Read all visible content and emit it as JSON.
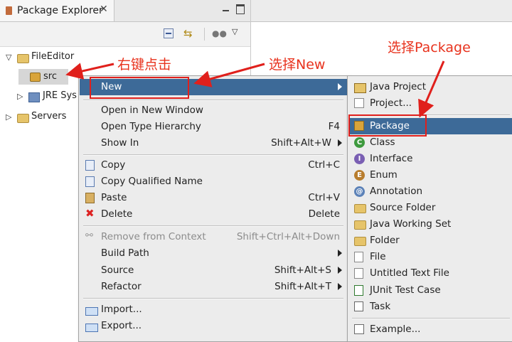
{
  "view": {
    "tab_title": "Package Explorer",
    "tab_close": "✕",
    "tree": {
      "fileeditor": "FileEditor",
      "src": "src",
      "jre": "JRE Sys",
      "servers": "Servers"
    }
  },
  "context_menu": {
    "items": [
      {
        "label": "New",
        "shortcut": "",
        "submenu": true,
        "selected": true,
        "icon": ""
      },
      {
        "label": "Open in New Window",
        "shortcut": "",
        "submenu": false,
        "icon": ""
      },
      {
        "label": "Open Type Hierarchy",
        "shortcut": "F4",
        "submenu": false,
        "icon": ""
      },
      {
        "label": "Show In",
        "shortcut": "Shift+Alt+W",
        "submenu": true,
        "icon": ""
      },
      {
        "label": "Copy",
        "shortcut": "Ctrl+C",
        "submenu": false,
        "icon": "copy-icon"
      },
      {
        "label": "Copy Qualified Name",
        "shortcut": "",
        "submenu": false,
        "icon": "copy-qualified-icon"
      },
      {
        "label": "Paste",
        "shortcut": "Ctrl+V",
        "submenu": false,
        "icon": "paste-icon"
      },
      {
        "label": "Delete",
        "shortcut": "Delete",
        "submenu": false,
        "icon": "delete-icon"
      },
      {
        "label": "Remove from Context",
        "shortcut": "Shift+Ctrl+Alt+Down",
        "submenu": false,
        "disabled": true,
        "icon": "remove-context-icon"
      },
      {
        "label": "Build Path",
        "shortcut": "",
        "submenu": true,
        "icon": ""
      },
      {
        "label": "Source",
        "shortcut": "Shift+Alt+S",
        "submenu": true,
        "icon": ""
      },
      {
        "label": "Refactor",
        "shortcut": "Shift+Alt+T",
        "submenu": true,
        "icon": ""
      },
      {
        "label": "Import...",
        "shortcut": "",
        "submenu": false,
        "icon": "import-icon"
      },
      {
        "label": "Export...",
        "shortcut": "",
        "submenu": false,
        "icon": "export-icon"
      }
    ]
  },
  "submenu": {
    "items": [
      {
        "label": "Java Project",
        "icon": "java-project-icon"
      },
      {
        "label": "Project...",
        "icon": "project-icon"
      },
      {
        "label": "Package",
        "icon": "package-icon",
        "selected": true
      },
      {
        "label": "Class",
        "icon": "class-icon",
        "glyph": "C"
      },
      {
        "label": "Interface",
        "icon": "interface-icon",
        "glyph": "I"
      },
      {
        "label": "Enum",
        "icon": "enum-icon",
        "glyph": "E"
      },
      {
        "label": "Annotation",
        "icon": "annotation-icon",
        "glyph": "@"
      },
      {
        "label": "Source Folder",
        "icon": "source-folder-icon"
      },
      {
        "label": "Java Working Set",
        "icon": "working-set-icon"
      },
      {
        "label": "Folder",
        "icon": "folder-icon"
      },
      {
        "label": "File",
        "icon": "file-icon"
      },
      {
        "label": "Untitled Text File",
        "icon": "text-file-icon"
      },
      {
        "label": "JUnit Test Case",
        "icon": "junit-icon"
      },
      {
        "label": "Task",
        "icon": "task-icon"
      },
      {
        "label": "Example...",
        "icon": "example-icon"
      }
    ]
  },
  "annotations": {
    "right_click": "右键点击",
    "choose_new": "选择New",
    "choose_package": "选择Package",
    "color": "#e0201c"
  },
  "colors": {
    "selection": "#3d6a98",
    "menu_bg": "#ececec"
  }
}
